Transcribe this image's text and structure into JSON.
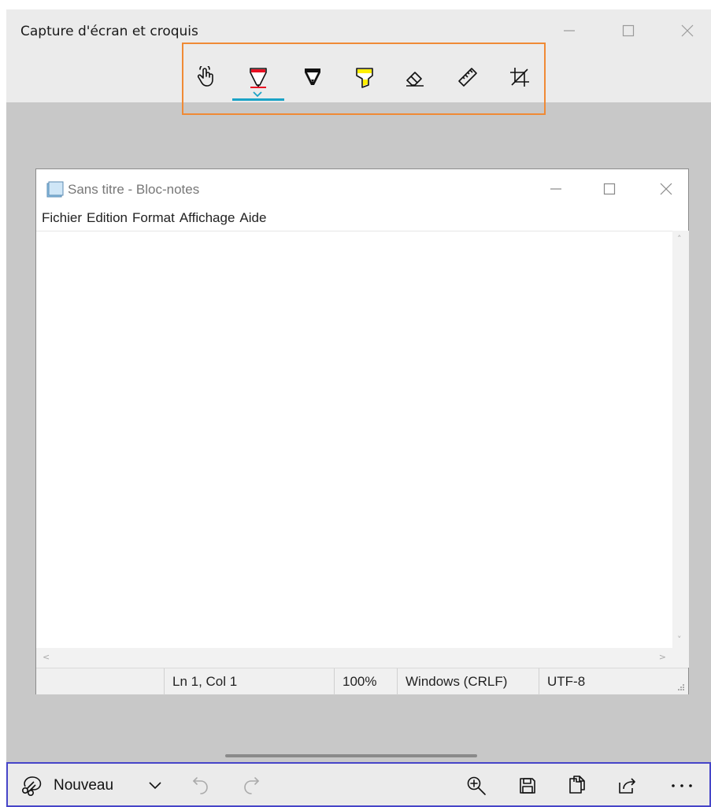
{
  "app": {
    "title": "Capture d'écran et croquis"
  },
  "toolbar": {
    "tools": [
      {
        "name": "touch-writing",
        "icon": "touch-hand-icon"
      },
      {
        "name": "ballpoint-pen",
        "icon": "ballpoint-pen-icon",
        "color": "#e81123",
        "selected": true
      },
      {
        "name": "pencil",
        "icon": "pencil-icon",
        "color": "#000000"
      },
      {
        "name": "highlighter",
        "icon": "highlighter-icon",
        "color": "#ffef00"
      },
      {
        "name": "eraser",
        "icon": "eraser-icon"
      },
      {
        "name": "ruler",
        "icon": "ruler-icon"
      },
      {
        "name": "crop",
        "icon": "crop-icon"
      }
    ],
    "accent": "#1ba3c6",
    "highlight_border": "#f08a35"
  },
  "notepad": {
    "title": "Sans titre - Bloc-notes",
    "menu": [
      "Fichier",
      "Edition",
      "Format",
      "Affichage",
      "Aide"
    ],
    "status": {
      "position": "Ln 1, Col 1",
      "zoom": "100%",
      "line_ending": "Windows (CRLF)",
      "encoding": "UTF-8"
    }
  },
  "bottombar": {
    "new_label": "Nouveau",
    "border": "#4645c8"
  }
}
